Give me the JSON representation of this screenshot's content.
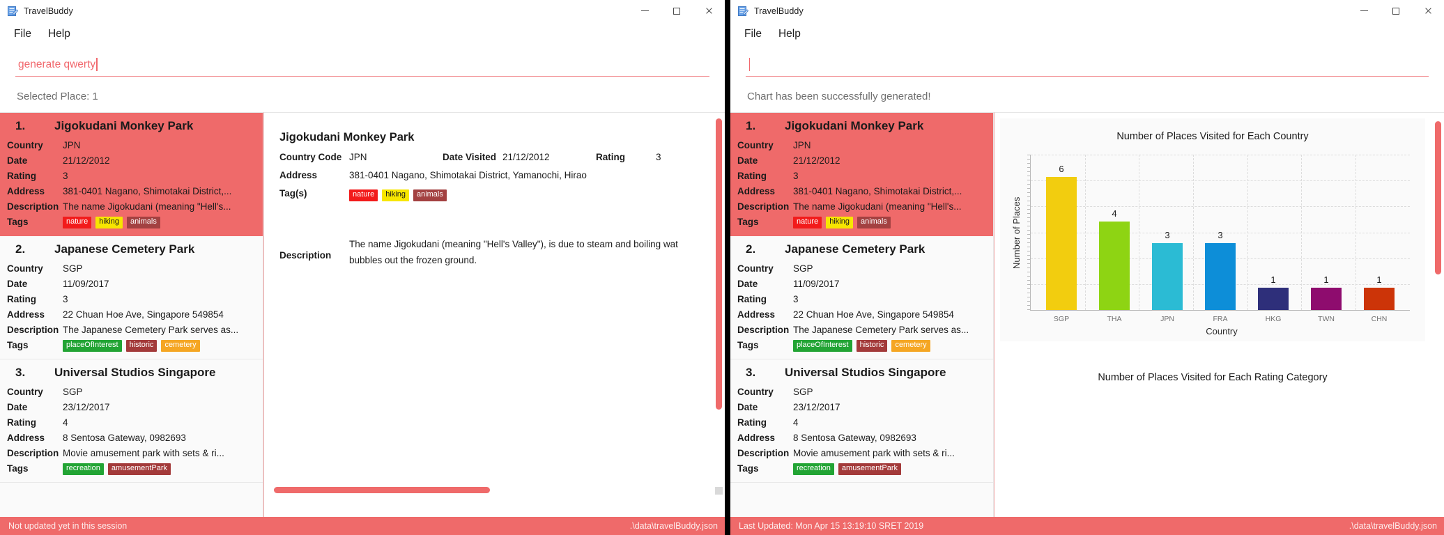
{
  "windows": {
    "left": {
      "title": "TravelBuddy",
      "icon": "app-notepad-icon",
      "controls": {
        "minimize": "minimize-icon",
        "maximize": "maximize-icon",
        "close": "close-icon"
      },
      "menu": [
        "File",
        "Help"
      ],
      "command_input": {
        "value": "generate qwerty",
        "placeholder": ""
      },
      "status_message": "Selected Place: 1",
      "statusbar": {
        "left": "Not updated yet in this session",
        "right": ".\\data\\travelBuddy.json"
      }
    },
    "right": {
      "title": "TravelBuddy",
      "icon": "app-notepad-icon",
      "controls": {
        "minimize": "minimize-icon",
        "maximize": "maximize-icon",
        "close": "close-icon"
      },
      "menu": [
        "File",
        "Help"
      ],
      "command_input": {
        "value": "",
        "placeholder": ""
      },
      "status_message": "Chart has been successfully generated!",
      "statusbar": {
        "left": "Last Updated: Mon Apr 15 13:19:10 SRET 2019",
        "right": ".\\data\\travelBuddy.json"
      }
    }
  },
  "field_labels": {
    "country": "Country",
    "date": "Date",
    "rating": "Rating",
    "address": "Address",
    "description": "Description",
    "tags": "Tags"
  },
  "places": [
    {
      "index": "1.",
      "name": "Jigokudani Monkey Park",
      "country": "JPN",
      "date": "21/12/2012",
      "rating": "3",
      "address": "381-0401 Nagano, Shimotakai District,...",
      "description": "The name Jigokudani (meaning \"Hell's...",
      "tags": [
        {
          "label": "nature",
          "color": "#f21b1b"
        },
        {
          "label": "hiking",
          "color": "#f7e600",
          "text_color": "#1b1b1b"
        },
        {
          "label": "animals",
          "color": "#a34141"
        }
      ],
      "selected": true
    },
    {
      "index": "2.",
      "name": "Japanese Cemetery Park",
      "country": "SGP",
      "date": "11/09/2017",
      "rating": "3",
      "address": "22 Chuan Hoe Ave, Singapore 549854",
      "description": "The Japanese Cemetery Park serves as...",
      "tags": [
        {
          "label": "placeOfInterest",
          "color": "#22a434"
        },
        {
          "label": "historic",
          "color": "#a33a3a"
        },
        {
          "label": "cemetery",
          "color": "#f5a623"
        }
      ],
      "selected": false
    },
    {
      "index": "3.",
      "name": "Universal Studios Singapore",
      "country": "SGP",
      "date": "23/12/2017",
      "rating": "4",
      "address": "8 Sentosa Gateway, 0982693",
      "description": "Movie amusement park with sets & ri...",
      "tags": [
        {
          "label": "recreation",
          "color": "#22a434"
        },
        {
          "label": "amusementPark",
          "color": "#a33a3a"
        }
      ],
      "selected": false
    }
  ],
  "detail": {
    "title": "Jigokudani Monkey Park",
    "labels": {
      "country_code": "Country Code",
      "date_visited": "Date Visited",
      "rating": "Rating",
      "address": "Address",
      "tags": "Tag(s)",
      "description": "Description"
    },
    "country_code": "JPN",
    "date_visited": "21/12/2012",
    "rating": "3",
    "address": "381-0401 Nagano, Shimotakai District, Yamanochi, Hirao",
    "tags": [
      {
        "label": "nature",
        "color": "#f21b1b"
      },
      {
        "label": "hiking",
        "color": "#f7e600",
        "text_color": "#1b1b1b"
      },
      {
        "label": "animals",
        "color": "#a34141"
      }
    ],
    "description": "The name Jigokudani (meaning \"Hell's Valley\"), is due to steam and boiling wat\nbubbles out the frozen ground."
  },
  "chart_data": [
    {
      "type": "bar",
      "title": "Number of Places Visited for Each Country",
      "xlabel": "Country",
      "ylabel": "Number of Places",
      "categories": [
        "SGP",
        "THA",
        "JPN",
        "FRA",
        "HKG",
        "TWN",
        "CHN"
      ],
      "values": [
        6,
        4,
        3,
        3,
        1,
        1,
        1
      ],
      "colors": [
        "#f2cd0f",
        "#8ed413",
        "#2bbbd4",
        "#0d8ed8",
        "#2e2f7a",
        "#8e0c6e",
        "#cc3408"
      ],
      "ylim": [
        0,
        7
      ],
      "grid": true,
      "legend": "none",
      "data_labels": [
        "6",
        "4",
        "3",
        "3",
        "1",
        "1",
        "1"
      ]
    },
    {
      "type": "bar",
      "title": "Number of Places Visited for Each Rating Category",
      "xlabel": "",
      "ylabel": "",
      "categories": [],
      "values": [],
      "grid": false,
      "legend": "none"
    }
  ]
}
